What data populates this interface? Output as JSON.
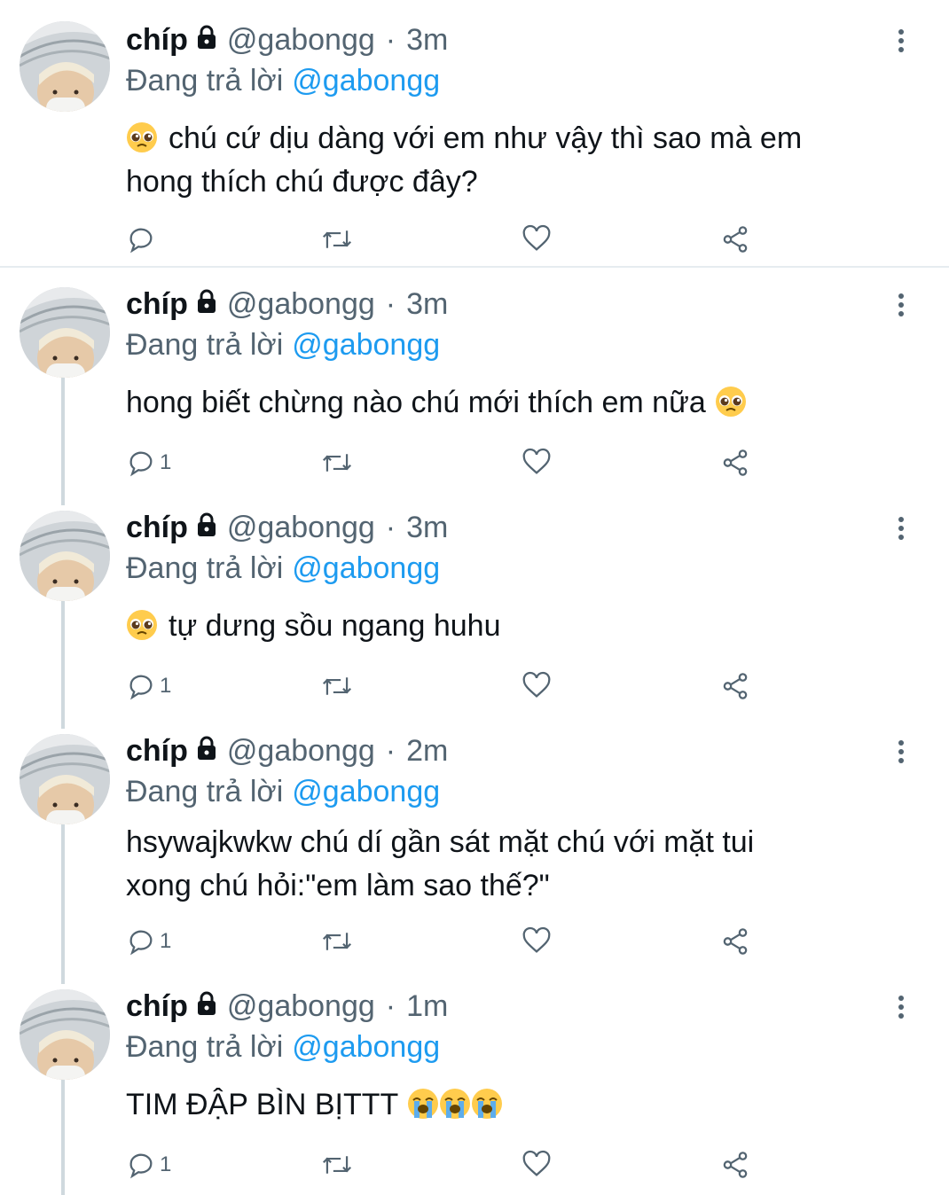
{
  "accent_color": "#1d9bf0",
  "muted_color": "#536471",
  "tweets": [
    {
      "name": "chíp",
      "handle": "@gabongg",
      "dot": "·",
      "time": "3m",
      "replying_label": "Đang trả lời",
      "replying_to": "@gabongg",
      "text_lines": [
        "chú cứ dịu dàng với em như vậy thì sao mà em",
        "hong thích chú được đây?"
      ],
      "emoji_lead": "pleading-face",
      "reply_count": ""
    },
    {
      "name": "chíp",
      "handle": "@gabongg",
      "dot": "·",
      "time": "3m",
      "replying_label": "Đang trả lời",
      "replying_to": "@gabongg",
      "text_lines": [
        "hong biết chừng nào chú mới thích em nữa"
      ],
      "emoji_trail": "pleading-face",
      "reply_count": "1"
    },
    {
      "name": "chíp",
      "handle": "@gabongg",
      "dot": "·",
      "time": "3m",
      "replying_label": "Đang trả lời",
      "replying_to": "@gabongg",
      "text_lines": [
        "tự dưng sồu ngang huhu"
      ],
      "emoji_lead": "pleading-face",
      "reply_count": "1"
    },
    {
      "name": "chíp",
      "handle": "@gabongg",
      "dot": "·",
      "time": "2m",
      "replying_label": "Đang trả lời",
      "replying_to": "@gabongg",
      "text_lines": [
        "hsywajkwkw chú dí gần sát mặt chú với mặt tui",
        "xong chú hỏi:\"em làm sao thế?\""
      ],
      "reply_count": "1"
    },
    {
      "name": "chíp",
      "handle": "@gabongg",
      "dot": "·",
      "time": "1m",
      "replying_label": "Đang trả lời",
      "replying_to": "@gabongg",
      "text_lines": [
        "TIM ĐẬP BÌN BỊTTT"
      ],
      "emoji_trail": "loudly-crying-face x3",
      "reply_count": "1"
    }
  ]
}
